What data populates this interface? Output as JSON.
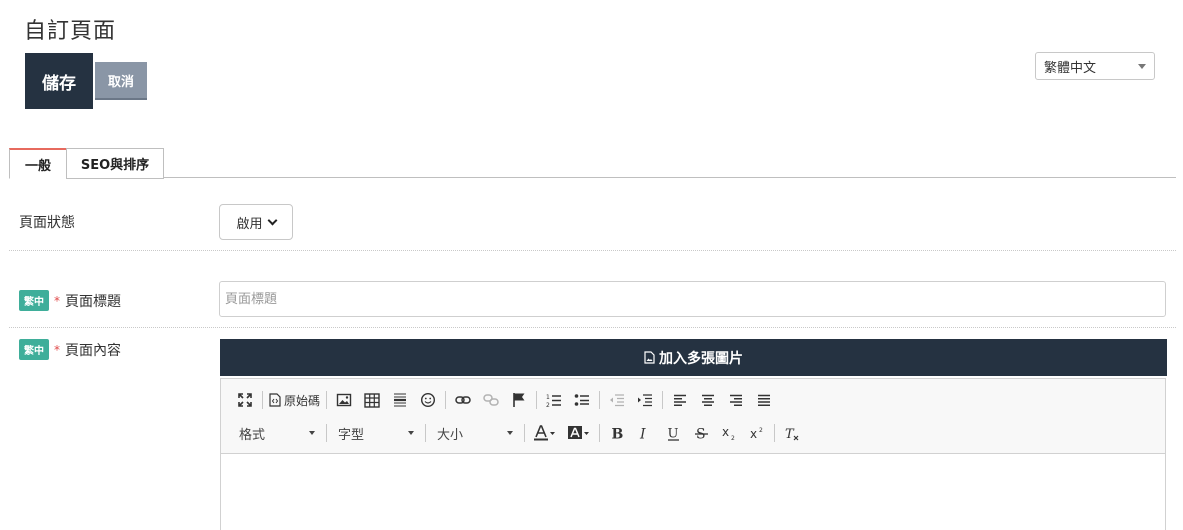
{
  "header": {
    "title": "自訂頁面"
  },
  "actions": {
    "save_label": "儲存",
    "cancel_label": "取消"
  },
  "language": {
    "selected": "繁體中文"
  },
  "tabs": [
    {
      "label": "一般",
      "active": true
    },
    {
      "label": "SEO與排序",
      "active": false
    }
  ],
  "form": {
    "status": {
      "label": "頁面狀態",
      "value": "啟用"
    },
    "page_title": {
      "badge": "繁中",
      "required_mark": "*",
      "label": "頁面標題",
      "placeholder": "頁面標題",
      "value": ""
    },
    "page_content": {
      "badge": "繁中",
      "required_mark": "*",
      "label": "頁面內容",
      "add_images_label": "加入多張圖片"
    }
  },
  "editor": {
    "source_label": "原始碼",
    "format_label": "格式",
    "font_label": "字型",
    "size_label": "大小",
    "toolbar_row1_icons": [
      "maximize-icon",
      "source-icon",
      "image-icon",
      "table-icon",
      "horizontal-line-icon",
      "smiley-icon",
      "link-icon",
      "unlink-icon",
      "anchor-flag-icon",
      "numbered-list-icon",
      "bulleted-list-icon",
      "outdent-icon",
      "indent-icon",
      "align-left-icon",
      "align-center-icon",
      "align-right-icon",
      "justify-icon"
    ],
    "toolbar_row2_icons": [
      "text-color-icon",
      "background-color-icon",
      "bold-icon",
      "italic-icon",
      "underline-icon",
      "strikethrough-icon",
      "subscript-icon",
      "superscript-icon",
      "remove-format-icon"
    ]
  },
  "colors": {
    "dark_navy": "#253241",
    "cancel_gray": "#8a96a6",
    "badge_teal": "#3fae9a",
    "tab_accent": "#e76a5e",
    "required_red": "#e04a4a"
  }
}
